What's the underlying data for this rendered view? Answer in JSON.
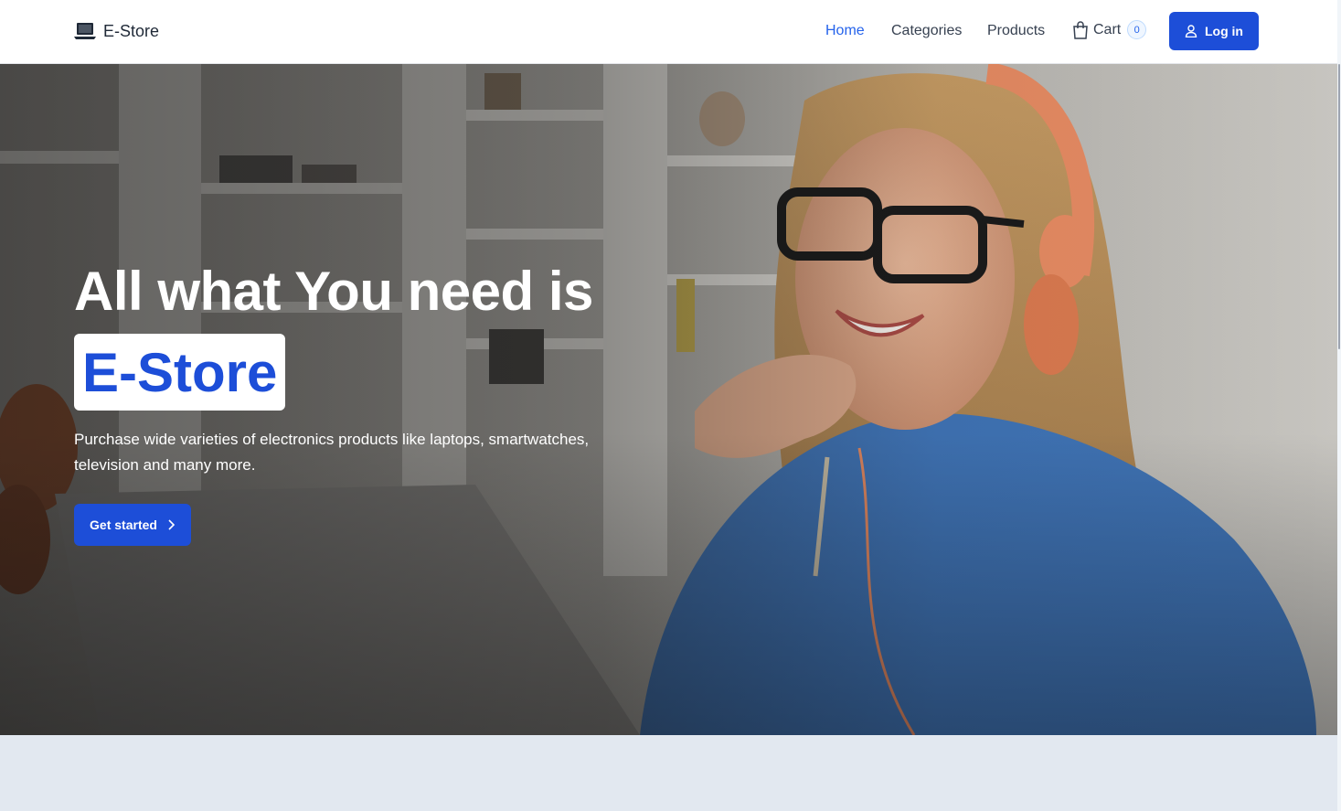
{
  "brand": {
    "name": "E-Store",
    "icon": "laptop-icon"
  },
  "nav": {
    "items": [
      {
        "label": "Home",
        "active": true
      },
      {
        "label": "Categories",
        "active": false
      },
      {
        "label": "Products",
        "active": false
      }
    ],
    "cart": {
      "label": "Cart",
      "count": "0",
      "icon": "shopping-bag-icon"
    },
    "login": {
      "label": "Log in",
      "icon": "user-icon"
    }
  },
  "hero": {
    "title": "All what You need is",
    "highlight": "E-Store",
    "description": "Purchase wide varieties of electronics products like laptops, smartwatches, television and many more.",
    "cta": {
      "label": "Get started",
      "icon": "chevron-right-icon"
    }
  },
  "colors": {
    "accent": "#1d4ed8",
    "active_link": "#2563eb",
    "section_bg": "#e2e8f0"
  }
}
